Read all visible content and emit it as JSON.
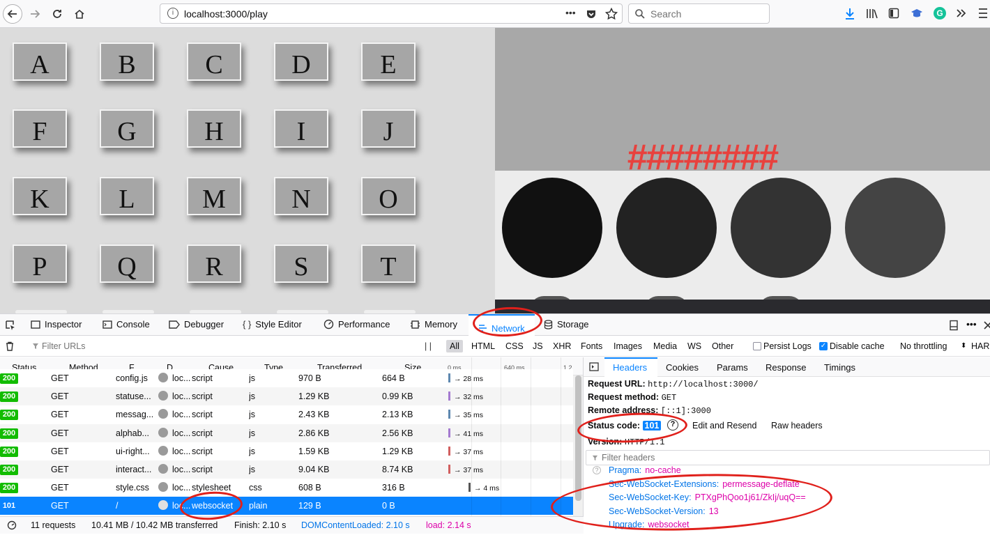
{
  "browser": {
    "url": "localhost:3000/play",
    "search_placeholder": "Search",
    "page_actions": "•••"
  },
  "keyboard": {
    "keys": [
      "A",
      "B",
      "C",
      "D",
      "E",
      "F",
      "G",
      "H",
      "I",
      "J",
      "K",
      "L",
      "M",
      "N",
      "O",
      "P",
      "Q",
      "R",
      "S",
      "T"
    ]
  },
  "game": {
    "hashes": "########",
    "circle_colors": [
      "#111111",
      "#222222",
      "#333333",
      "#444444"
    ]
  },
  "devtools": {
    "tabs": [
      "Inspector",
      "Console",
      "Debugger",
      "Style Editor",
      "Performance",
      "Memory",
      "Network",
      "Storage"
    ],
    "active_tab": "Network",
    "filter_placeholder": "Filter URLs",
    "type_filters": [
      "All",
      "HTML",
      "CSS",
      "JS",
      "XHR",
      "Fonts",
      "Images",
      "Media",
      "WS",
      "Other"
    ],
    "persist_logs": "Persist Logs",
    "disable_cache": "Disable cache",
    "throttling": "No throttling",
    "har": "HAR",
    "columns": [
      "Status",
      "Method",
      "F...",
      "D...",
      "Cause",
      "Type",
      "Transferred",
      "Size",
      "0 ms",
      "640 ms",
      "1.2"
    ],
    "rows": [
      {
        "status": "200",
        "method": "GET",
        "file": "config.js",
        "domain": "loc...",
        "cause": "script",
        "type": "js",
        "transferred": "970 B",
        "size": "664 B",
        "timing": "→ 28 ms"
      },
      {
        "status": "200",
        "method": "GET",
        "file": "statuse...",
        "domain": "loc...",
        "cause": "script",
        "type": "js",
        "transferred": "1.29 KB",
        "size": "0.99 KB",
        "timing": "→ 32 ms"
      },
      {
        "status": "200",
        "method": "GET",
        "file": "messag...",
        "domain": "loc...",
        "cause": "script",
        "type": "js",
        "transferred": "2.43 KB",
        "size": "2.13 KB",
        "timing": "→ 35 ms"
      },
      {
        "status": "200",
        "method": "GET",
        "file": "alphab...",
        "domain": "loc...",
        "cause": "script",
        "type": "js",
        "transferred": "2.86 KB",
        "size": "2.56 KB",
        "timing": "→ 41 ms"
      },
      {
        "status": "200",
        "method": "GET",
        "file": "ui-right...",
        "domain": "loc...",
        "cause": "script",
        "type": "js",
        "transferred": "1.59 KB",
        "size": "1.29 KB",
        "timing": "→ 37 ms"
      },
      {
        "status": "200",
        "method": "GET",
        "file": "interact...",
        "domain": "loc...",
        "cause": "script",
        "type": "js",
        "transferred": "9.04 KB",
        "size": "8.74 KB",
        "timing": "→ 37 ms"
      },
      {
        "status": "200",
        "method": "GET",
        "file": "style.css",
        "domain": "loc...",
        "cause": "stylesheet",
        "type": "css",
        "transferred": "608 B",
        "size": "316 B",
        "timing": "→ 4 ms"
      },
      {
        "status": "101",
        "method": "GET",
        "file": "/",
        "domain": "loc...",
        "cause": "websocket",
        "type": "plain",
        "transferred": "129 B",
        "size": "0 B",
        "timing": ""
      }
    ],
    "summary": {
      "requests": "11 requests",
      "transferred": "10.41 MB / 10.42 MB transferred",
      "finish": "Finish: 2.10 s",
      "domcontentloaded": "DOMContentLoaded: 2.10 s",
      "load": "load: 2.14 s"
    },
    "detail_tabs": [
      "Headers",
      "Cookies",
      "Params",
      "Response",
      "Timings"
    ],
    "active_detail_tab": "Headers",
    "request_url_label": "Request URL:",
    "request_url": "http://localhost:3000/",
    "request_method_label": "Request method:",
    "request_method": "GET",
    "remote_address_label": "Remote address:",
    "remote_address": "[::1]:3000",
    "status_code_label": "Status code:",
    "status_code": "101",
    "edit_resend": "Edit and Resend",
    "raw_headers": "Raw headers",
    "version_label": "Version:",
    "version": "HTTP/1.1",
    "filter_headers_placeholder": "Filter headers",
    "headers": [
      {
        "key": "Pragma:",
        "value": "no-cache"
      },
      {
        "key": "Sec-WebSocket-Extensions:",
        "value": "permessage-deflate"
      },
      {
        "key": "Sec-WebSocket-Key:",
        "value": "PTXgPhQoo1j61/ZkIj/uqQ=="
      },
      {
        "key": "Sec-WebSocket-Version:",
        "value": "13"
      },
      {
        "key": "Upgrade:",
        "value": "websocket"
      }
    ]
  },
  "colors": {
    "accent": "#0a84ff",
    "selected_row": "#0a84ff",
    "status_ok": "#12bc00",
    "annotation": "#e0201b",
    "hash_red": "#e8413d"
  }
}
